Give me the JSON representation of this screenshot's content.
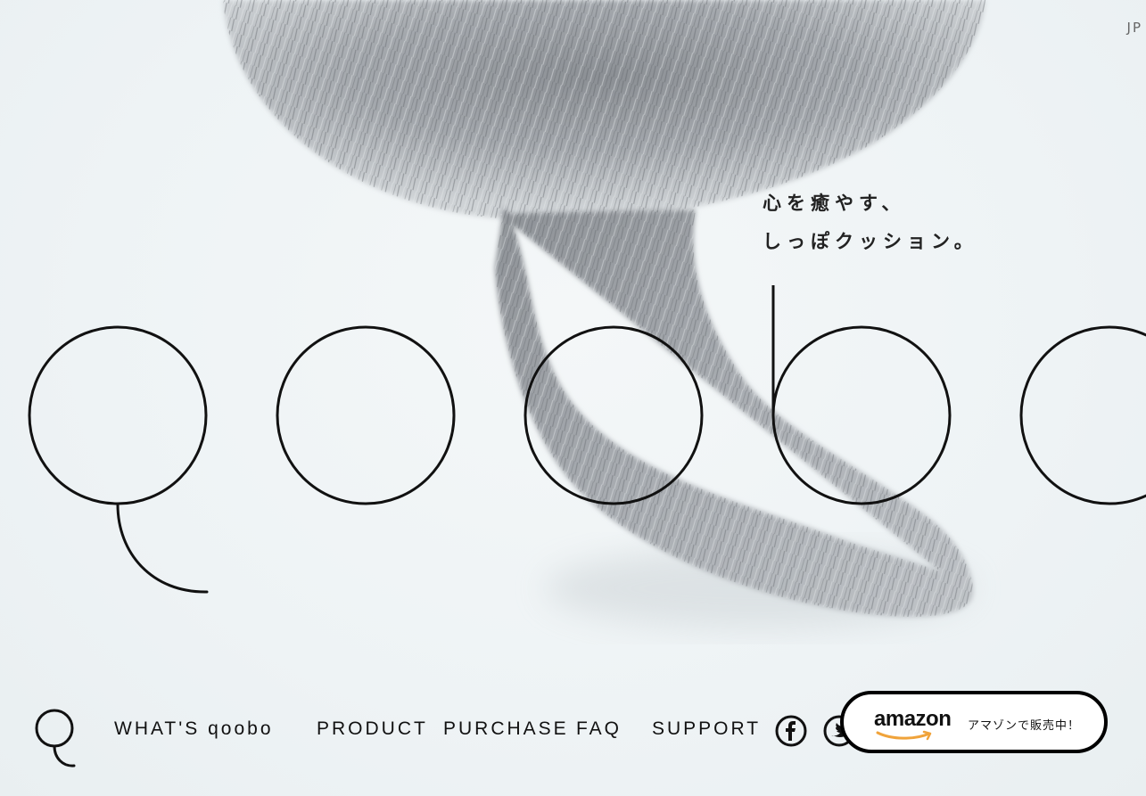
{
  "language": {
    "label": "JP"
  },
  "hero": {
    "tagline_line1": "心を癒やす、",
    "tagline_line2": "しっぽクッション。",
    "logo_wordmark": "qoobo"
  },
  "nav": {
    "items": [
      {
        "id": "whats-qoobo",
        "label": "WHAT'S qoobo"
      },
      {
        "id": "product",
        "label": "PRODUCT"
      },
      {
        "id": "purchase",
        "label": "PURCHASE"
      },
      {
        "id": "faq",
        "label": "FAQ"
      },
      {
        "id": "support",
        "label": "SUPPORT"
      }
    ],
    "social": [
      {
        "name": "facebook-icon",
        "glyph": "f"
      },
      {
        "name": "twitter-icon",
        "glyph": "t"
      }
    ]
  },
  "amazon": {
    "brand": "amazon",
    "cta": "アマゾンで販売中！"
  },
  "colors": {
    "background": "#eef3f5",
    "fur_dark": "#6f7378",
    "fur_light": "#d9dcdf",
    "ink": "#111111"
  }
}
